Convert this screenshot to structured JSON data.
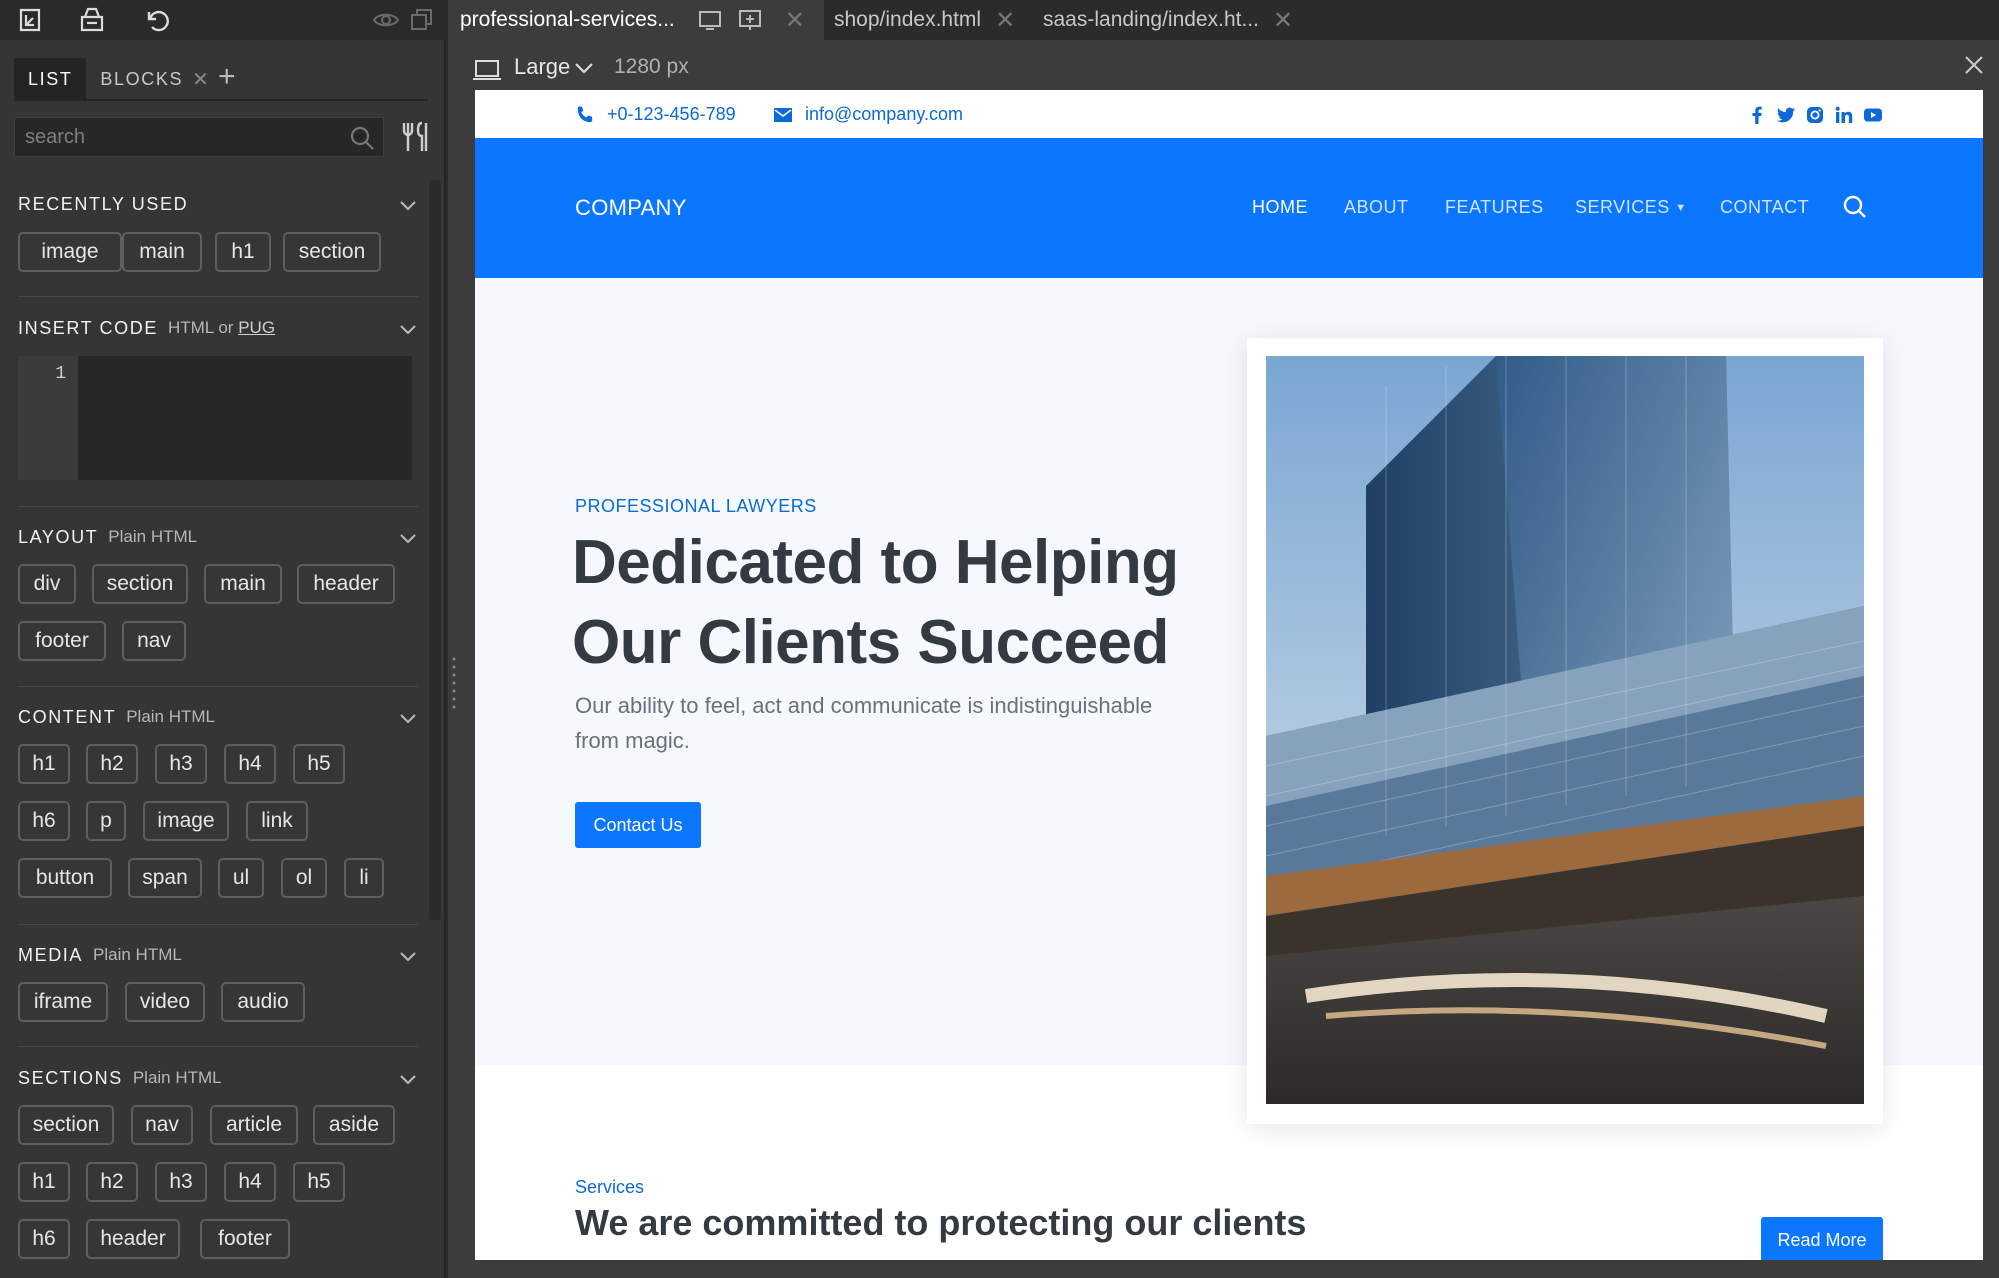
{
  "toolbar": {
    "export_icon": "export-icon",
    "package_icon": "package-icon",
    "undo_icon": "undo-icon",
    "preview_icon": "eye-icon",
    "window_icon": "window-icon"
  },
  "sidebar": {
    "tabs": [
      {
        "label": "LIST"
      },
      {
        "label": "BLOCKS",
        "close": "✕"
      }
    ],
    "add_tab": "+",
    "search_placeholder": "search",
    "recently_used": {
      "title": "RECENTLY USED",
      "items": [
        "image",
        "main",
        "h1",
        "section"
      ]
    },
    "insert_code": {
      "title": "INSERT CODE",
      "sub": "HTML or",
      "link": "PUG",
      "line_number": "1"
    },
    "layout": {
      "title": "LAYOUT",
      "sub": "Plain HTML",
      "items": [
        "div",
        "section",
        "main",
        "header",
        "footer",
        "nav"
      ]
    },
    "content": {
      "title": "CONTENT",
      "sub": "Plain HTML",
      "items": [
        "h1",
        "h2",
        "h3",
        "h4",
        "h5",
        "h6",
        "p",
        "image",
        "link",
        "button",
        "span",
        "ul",
        "ol",
        "li"
      ]
    },
    "media": {
      "title": "MEDIA",
      "sub": "Plain HTML",
      "items": [
        "iframe",
        "video",
        "audio"
      ]
    },
    "sections": {
      "title": "SECTIONS",
      "sub": "Plain HTML",
      "items": [
        "section",
        "nav",
        "article",
        "aside",
        "h1",
        "h2",
        "h3",
        "h4",
        "h5",
        "h6",
        "header",
        "footer"
      ]
    }
  },
  "editor_tabs": [
    {
      "label": "professional-services..."
    },
    {
      "label": "shop/index.html"
    },
    {
      "label": "saas-landing/index.ht..."
    }
  ],
  "viewbar": {
    "device": "Large",
    "width": "1280 px"
  },
  "site": {
    "phone": "+0-123-456-789",
    "email": "info@company.com",
    "brand": "COMPANY",
    "nav": [
      "HOME",
      "ABOUT",
      "FEATURES",
      "SERVICES",
      "CONTACT"
    ],
    "hero_eyebrow": "PROFESSIONAL LAWYERS",
    "hero_title_line1": "Dedicated to Helping",
    "hero_title_line2": "Our Clients Succeed",
    "hero_text": "Our ability to feel, act and communicate is indistinguishable from magic.",
    "cta": "Contact Us",
    "services_eyebrow": "Services",
    "services_title": "We are committed to protecting our clients",
    "read_more": "Read More"
  },
  "colors": {
    "accent": "#0b76ff",
    "link": "#0b6ad8",
    "sidebar": "#353535",
    "heading": "#333a41"
  }
}
